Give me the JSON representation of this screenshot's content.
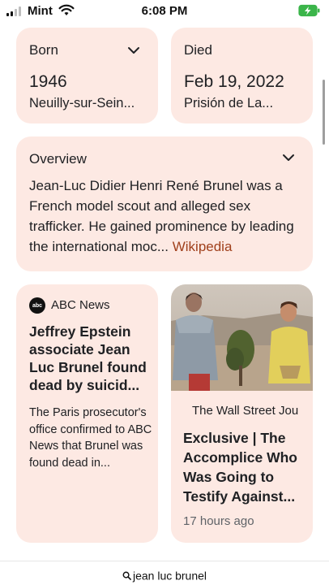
{
  "status_bar": {
    "carrier": "Mint",
    "time": "6:08 PM",
    "signal_icon": "signal-bars-icon",
    "wifi_icon": "wifi-icon",
    "battery_icon": "battery-charging-icon",
    "battery_color": "#3bb54a"
  },
  "born": {
    "label": "Born",
    "year": "1946",
    "place": "Neuilly-sur-Sein..."
  },
  "died": {
    "label": "Died",
    "date": "Feb 19, 2022",
    "place": "Prisión de La..."
  },
  "overview": {
    "label": "Overview",
    "text": "Jean-Luc Didier Henri René Brunel was a French model scout and alleged sex trafficker. He gained prominence by leading the international moc...",
    "link": "Wikipedia"
  },
  "news": [
    {
      "source": "ABC News",
      "logo_text": "abc",
      "headline": "Jeffrey Epstein associate Jean Luc Brunel found dead by suicid...",
      "snippet": "The Paris prosecutor's office confirmed to ABC News that Brunel was found dead in..."
    },
    {
      "source": "The Wall Street Jou",
      "headline": "Exclusive | The Accomplice Who Was Going to Testify Against...",
      "time": "17 hours ago"
    }
  ],
  "bottom_bar": {
    "query": "jean luc brunel"
  },
  "colors": {
    "card_background": "#fde9e3",
    "link_color": "#a0401c"
  }
}
